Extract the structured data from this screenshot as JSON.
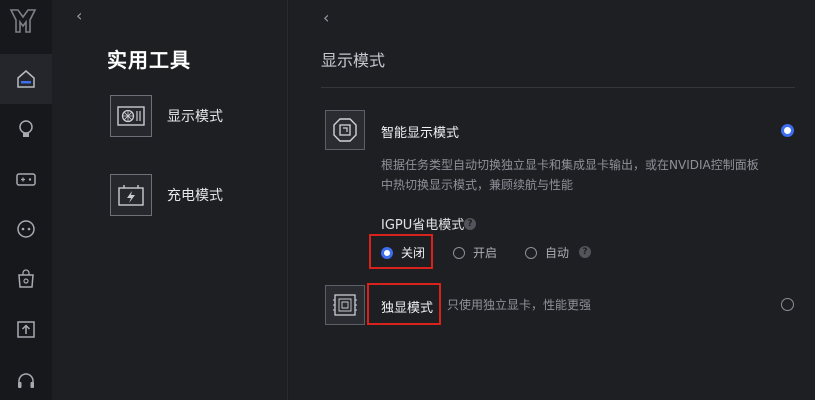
{
  "rail": {
    "items": [
      {
        "icon": "home-icon",
        "active": true
      },
      {
        "icon": "bulb-icon",
        "active": false
      },
      {
        "icon": "gamepad-icon",
        "active": false
      },
      {
        "icon": "chat-icon",
        "active": false
      },
      {
        "icon": "shop-icon",
        "active": false
      },
      {
        "icon": "upload-icon",
        "active": false
      },
      {
        "icon": "headset-icon",
        "active": false
      }
    ]
  },
  "mid": {
    "back": "‹",
    "title": "实用工具",
    "tools": [
      {
        "label": "显示模式",
        "icon": "display-card-icon"
      },
      {
        "label": "充电模式",
        "icon": "battery-charge-icon"
      }
    ]
  },
  "right": {
    "back": "‹",
    "title": "显示模式",
    "smart_mode": {
      "name": "智能显示模式",
      "selected": true,
      "description_line1": "根据任务类型自动切换独立显卡和集成显卡输出，或在NVIDIA控制面板",
      "description_line2": "中热切换显示模式，兼顾续航与性能"
    },
    "igpu": {
      "label": "IGPU省电模式",
      "help": "?",
      "options": [
        {
          "label": "关闭",
          "selected": true
        },
        {
          "label": "开启",
          "selected": false
        },
        {
          "label": "自动",
          "selected": false
        }
      ],
      "auto_help": "?"
    },
    "discrete_mode": {
      "name": "独显模式",
      "description": "只使用独立显卡，性能更强",
      "selected": false
    }
  },
  "colors": {
    "accent": "#3e6ef0",
    "highlight_box": "#d9221c",
    "background": "#1e1f23"
  }
}
